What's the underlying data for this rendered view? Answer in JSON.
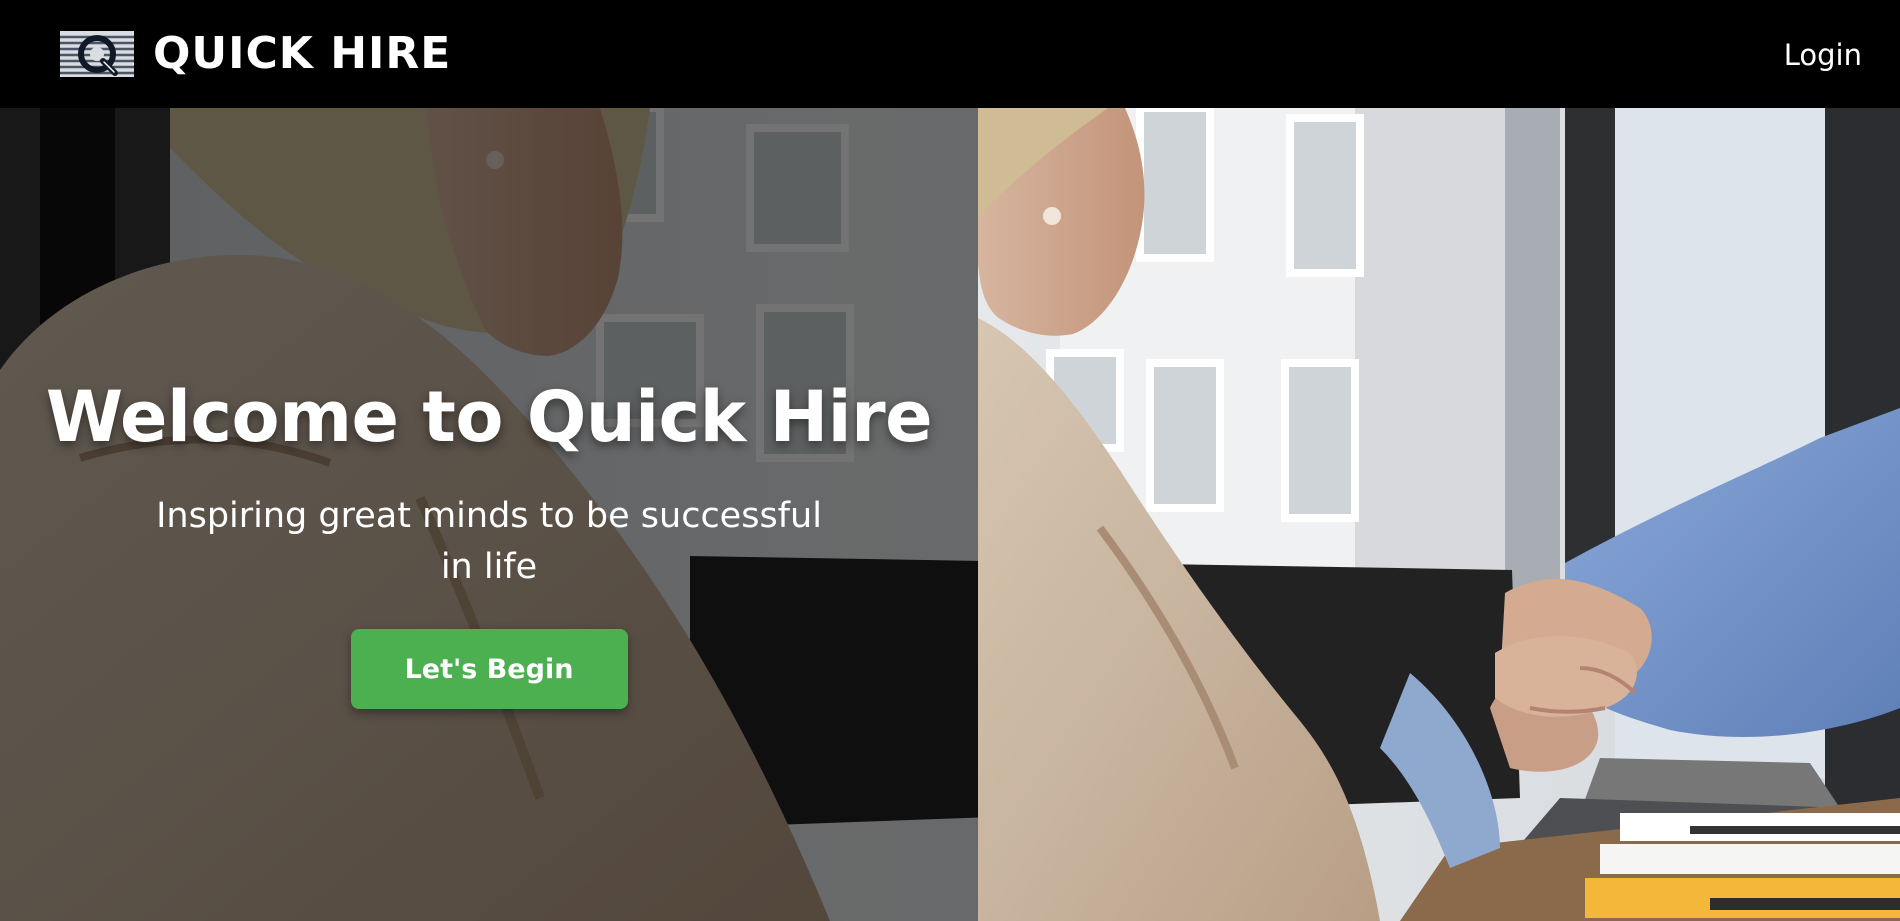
{
  "header": {
    "brand_name": "QUICK HIRE",
    "logo_icon": "quick-hire-q-logo-icon",
    "login_label": "Login"
  },
  "hero": {
    "title": "Welcome to Quick Hire",
    "subtitle": "Inspiring great minds to be successful in life",
    "cta_label": "Let's Begin",
    "photo_subject": "handshake-photo"
  },
  "colors": {
    "header_bg": "#000000",
    "cta_green": "#4caf50",
    "text": "#ffffff"
  }
}
